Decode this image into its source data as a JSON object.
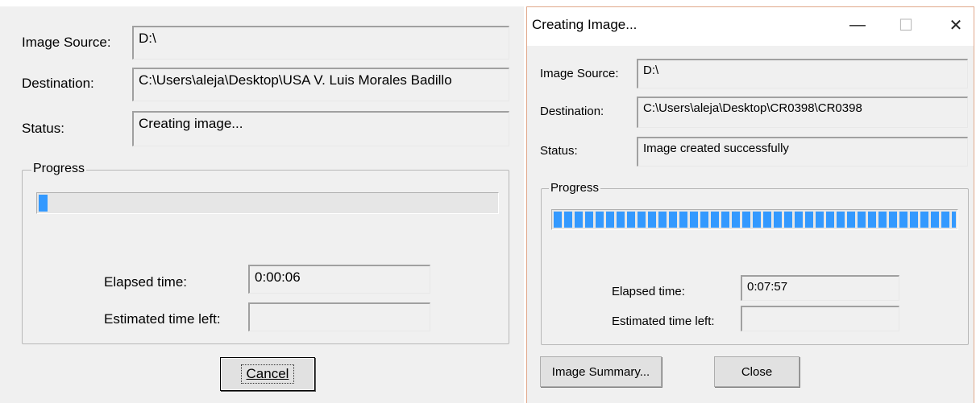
{
  "left": {
    "image_source_label": "Image Source:",
    "image_source_value": "D:\\",
    "destination_label": "Destination:",
    "destination_value": "C:\\Users\\aleja\\Desktop\\USA V. Luis Morales Badillo",
    "status_label": "Status:",
    "status_value": "Creating image...",
    "progress_legend": "Progress",
    "progress_fraction": 0.02,
    "elapsed_label": "Elapsed time:",
    "elapsed_value": "0:00:06",
    "estimated_label": "Estimated time left:",
    "estimated_value": "",
    "cancel_label": "Cancel"
  },
  "right": {
    "window_title": "Creating Image...",
    "minimize_glyph": "—",
    "maximize_glyph": "☐",
    "close_glyph": "✕",
    "image_source_label": "Image Source:",
    "image_source_value": "D:\\",
    "destination_label": "Destination:",
    "destination_value": "C:\\Users\\aleja\\Desktop\\CR0398\\CR0398",
    "status_label": "Status:",
    "status_value": "Image created successfully",
    "progress_legend": "Progress",
    "progress_fraction": 1.0,
    "elapsed_label": "Elapsed time:",
    "elapsed_value": "0:07:57",
    "estimated_label": "Estimated time left:",
    "estimated_value": "",
    "summary_label": "Image Summary...",
    "close_label": "Close"
  },
  "colors": {
    "progress_fill": "#3399ff",
    "dialog_background": "#f0f0f0",
    "window_border": "#e0a78a"
  },
  "icons": {
    "minimize": "minimize-icon",
    "maximize": "maximize-icon",
    "close": "close-icon"
  }
}
